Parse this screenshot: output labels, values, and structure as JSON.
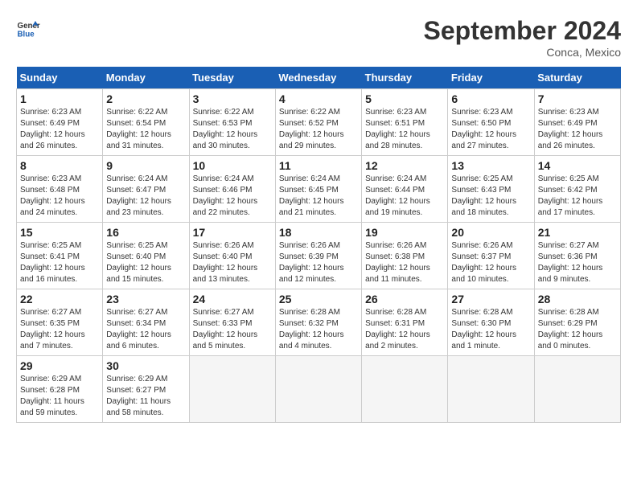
{
  "header": {
    "logo_line1": "General",
    "logo_line2": "Blue",
    "month_title": "September 2024",
    "location": "Conca, Mexico"
  },
  "weekdays": [
    "Sunday",
    "Monday",
    "Tuesday",
    "Wednesday",
    "Thursday",
    "Friday",
    "Saturday"
  ],
  "days": [
    {
      "num": "",
      "empty": true
    },
    {
      "num": "",
      "empty": true
    },
    {
      "num": "",
      "empty": true
    },
    {
      "num": "",
      "empty": true
    },
    {
      "num": "",
      "empty": true
    },
    {
      "num": "",
      "empty": true
    },
    {
      "num": "1",
      "rise": "6:23 AM",
      "set": "6:49 PM",
      "daylight": "12 hours and 26 minutes."
    },
    {
      "num": "2",
      "rise": "6:22 AM",
      "set": "6:54 PM",
      "daylight": "12 hours and 31 minutes."
    },
    {
      "num": "3",
      "rise": "6:22 AM",
      "set": "6:53 PM",
      "daylight": "12 hours and 30 minutes."
    },
    {
      "num": "4",
      "rise": "6:22 AM",
      "set": "6:52 PM",
      "daylight": "12 hours and 29 minutes."
    },
    {
      "num": "5",
      "rise": "6:23 AM",
      "set": "6:51 PM",
      "daylight": "12 hours and 28 minutes."
    },
    {
      "num": "6",
      "rise": "6:23 AM",
      "set": "6:50 PM",
      "daylight": "12 hours and 27 minutes."
    },
    {
      "num": "7",
      "rise": "6:23 AM",
      "set": "6:49 PM",
      "daylight": "12 hours and 26 minutes."
    },
    {
      "num": "8",
      "rise": "6:23 AM",
      "set": "6:48 PM",
      "daylight": "12 hours and 24 minutes."
    },
    {
      "num": "9",
      "rise": "6:24 AM",
      "set": "6:47 PM",
      "daylight": "12 hours and 23 minutes."
    },
    {
      "num": "10",
      "rise": "6:24 AM",
      "set": "6:46 PM",
      "daylight": "12 hours and 22 minutes."
    },
    {
      "num": "11",
      "rise": "6:24 AM",
      "set": "6:45 PM",
      "daylight": "12 hours and 21 minutes."
    },
    {
      "num": "12",
      "rise": "6:24 AM",
      "set": "6:44 PM",
      "daylight": "12 hours and 19 minutes."
    },
    {
      "num": "13",
      "rise": "6:25 AM",
      "set": "6:43 PM",
      "daylight": "12 hours and 18 minutes."
    },
    {
      "num": "14",
      "rise": "6:25 AM",
      "set": "6:42 PM",
      "daylight": "12 hours and 17 minutes."
    },
    {
      "num": "15",
      "rise": "6:25 AM",
      "set": "6:41 PM",
      "daylight": "12 hours and 16 minutes."
    },
    {
      "num": "16",
      "rise": "6:25 AM",
      "set": "6:40 PM",
      "daylight": "12 hours and 15 minutes."
    },
    {
      "num": "17",
      "rise": "6:26 AM",
      "set": "6:40 PM",
      "daylight": "12 hours and 13 minutes."
    },
    {
      "num": "18",
      "rise": "6:26 AM",
      "set": "6:39 PM",
      "daylight": "12 hours and 12 minutes."
    },
    {
      "num": "19",
      "rise": "6:26 AM",
      "set": "6:38 PM",
      "daylight": "12 hours and 11 minutes."
    },
    {
      "num": "20",
      "rise": "6:26 AM",
      "set": "6:37 PM",
      "daylight": "12 hours and 10 minutes."
    },
    {
      "num": "21",
      "rise": "6:27 AM",
      "set": "6:36 PM",
      "daylight": "12 hours and 9 minutes."
    },
    {
      "num": "22",
      "rise": "6:27 AM",
      "set": "6:35 PM",
      "daylight": "12 hours and 7 minutes."
    },
    {
      "num": "23",
      "rise": "6:27 AM",
      "set": "6:34 PM",
      "daylight": "12 hours and 6 minutes."
    },
    {
      "num": "24",
      "rise": "6:27 AM",
      "set": "6:33 PM",
      "daylight": "12 hours and 5 minutes."
    },
    {
      "num": "25",
      "rise": "6:28 AM",
      "set": "6:32 PM",
      "daylight": "12 hours and 4 minutes."
    },
    {
      "num": "26",
      "rise": "6:28 AM",
      "set": "6:31 PM",
      "daylight": "12 hours and 2 minutes."
    },
    {
      "num": "27",
      "rise": "6:28 AM",
      "set": "6:30 PM",
      "daylight": "12 hours and 1 minute."
    },
    {
      "num": "28",
      "rise": "6:28 AM",
      "set": "6:29 PM",
      "daylight": "12 hours and 0 minutes."
    },
    {
      "num": "29",
      "rise": "6:29 AM",
      "set": "6:28 PM",
      "daylight": "11 hours and 59 minutes."
    },
    {
      "num": "30",
      "rise": "6:29 AM",
      "set": "6:27 PM",
      "daylight": "11 hours and 58 minutes."
    },
    {
      "num": "",
      "empty": true
    },
    {
      "num": "",
      "empty": true
    },
    {
      "num": "",
      "empty": true
    },
    {
      "num": "",
      "empty": true
    },
    {
      "num": "",
      "empty": true
    }
  ]
}
